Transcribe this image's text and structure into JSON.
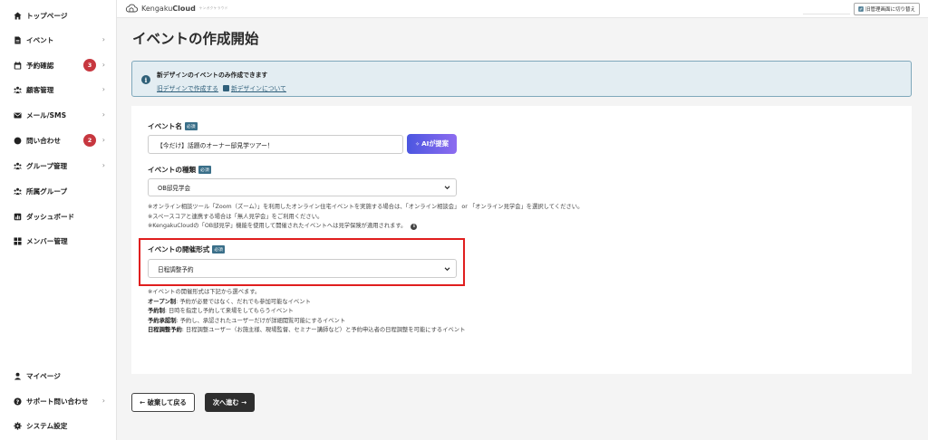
{
  "sidebar": {
    "items": [
      {
        "label": "トップページ",
        "icon": "home-icon"
      },
      {
        "label": "イベント",
        "icon": "document-icon",
        "chevron": "›"
      },
      {
        "label": "予約確認",
        "icon": "calendar-icon",
        "badge": "3",
        "chevron": "›"
      },
      {
        "label": "顧客管理",
        "icon": "users-icon",
        "chevron": "›"
      },
      {
        "label": "メール/SMS",
        "icon": "mail-icon",
        "chevron": "›"
      },
      {
        "label": "問い合わせ",
        "icon": "chat-icon",
        "badge": "2",
        "chevron": "›"
      },
      {
        "label": "グループ管理",
        "icon": "group-icon",
        "chevron": "›"
      },
      {
        "label": "所属グループ",
        "icon": "group-icon"
      },
      {
        "label": "ダッシュボード",
        "icon": "chart-icon"
      },
      {
        "label": "メンバー管理",
        "icon": "grid-icon"
      }
    ],
    "bottom_items": [
      {
        "label": "マイページ",
        "icon": "person-icon"
      },
      {
        "label": "サポート問い合わせ",
        "icon": "help-icon",
        "chevron": "›"
      },
      {
        "label": "システム設定",
        "icon": "gear-icon"
      }
    ]
  },
  "header": {
    "brand_prefix": "Kengaku",
    "brand_suffix": "Cloud",
    "brand_tag": "ケンガクケラウド",
    "switch_label": "旧管理画面に切り替え"
  },
  "page": {
    "title": "イベントの作成開始"
  },
  "notice": {
    "title": "新デザインのイベントのみ作成できます",
    "link_old": "旧デザインで作成する",
    "link_new": "新デザインについて"
  },
  "form": {
    "required_badge": "必須",
    "name_label": "イベント名",
    "name_value": "【今だけ】話題のオーナー邸見学ツアー！",
    "ai_button": "AIが提案",
    "type_label": "イベントの種類",
    "type_value": "OB邸見学会",
    "type_notes": [
      "※オンライン相談ツール「Zoom（ズーム）」を利用したオンライン住宅イベントを実施する場合は、「オンライン相談会」 or 「オンライン見学会」を選択してください。",
      "※スペースコアと連携する場合は「無人見学会」をご利用ください。",
      "※KengakuCloudの「OB邸見学」機能を使用して開催されたイベントへは見学保険が適用されます。"
    ],
    "format_label": "イベントの開催形式",
    "format_value": "日程調整予約",
    "format_notes": {
      "intro": "※イベントの開催形式は下記から選べます。",
      "items": [
        {
          "term": "オープン制",
          "desc": ": 予約が必要ではなく、だれでも参加可能なイベント"
        },
        {
          "term": "予約制",
          "desc": ": 日時を指定し予約して来場をしてもらうイベント"
        },
        {
          "term": "予約承認制",
          "desc": ": 予約し、承認されたユーザーだけが詳細閲覧可能にするイベント"
        },
        {
          "term": "日程調整予約",
          "desc": ": 日程調整ユーザー（お施主様、現場監督、セミナー講師など）と予約申込者の日程調整を可能にするイベント"
        }
      ]
    }
  },
  "footer": {
    "back_button": "← 破棄して戻る",
    "next_button": "次へ進む →"
  },
  "colors": {
    "badge_red": "#c7373f",
    "required_blue": "#3a6f89",
    "highlight_red": "#e01e1e",
    "notice_bg": "#e3edf2",
    "ai_gradient_start": "#4b56e0",
    "ai_gradient_end": "#8d6cf0"
  }
}
